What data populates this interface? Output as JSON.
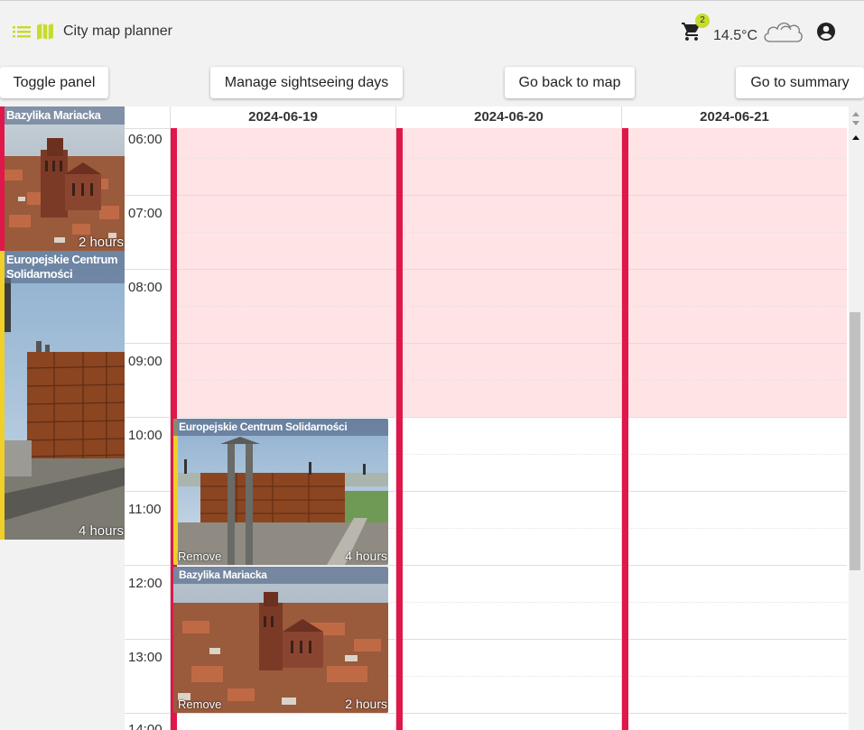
{
  "app": {
    "title": "City map planner",
    "icons": [
      "list-icon",
      "map-icon"
    ]
  },
  "header": {
    "cart_count": "2",
    "temperature": "14.5°C",
    "weather_icon": "cloud-icon",
    "account_icon": "account-circle-icon"
  },
  "toolbar": {
    "toggle_panel": "Toggle panel",
    "manage_days": "Manage sightseeing days",
    "back_to_map": "Go back to map",
    "summary": "Go to summary"
  },
  "panel": {
    "items": [
      {
        "title": "Bazylika Mariacka",
        "duration": "2 hours",
        "color": "#e0174a"
      },
      {
        "title": "Europejskie Centrum Solidarności",
        "duration": "4 hours",
        "color": "#f0d028"
      }
    ]
  },
  "calendar": {
    "days": [
      "2024-06-19",
      "2024-06-20",
      "2024-06-21"
    ],
    "times": [
      "06:00",
      "07:00",
      "08:00",
      "09:00",
      "10:00",
      "11:00",
      "12:00",
      "13:00",
      "14:00"
    ],
    "unavailable": {
      "from": "06:00",
      "to": "10:00",
      "color": "#ffe3e5"
    },
    "day_bar_color": "#e0174a",
    "events": [
      {
        "day": "2024-06-19",
        "start": "10:00",
        "end": "12:00",
        "title": "Europejskie Centrum Solidarności",
        "remove": "Remove",
        "duration": "4 hours",
        "color": "#f0d028"
      },
      {
        "day": "2024-06-19",
        "start": "12:00",
        "end": "14:00",
        "title": "Bazylika Mariacka",
        "remove": "Remove",
        "duration": "2 hours",
        "color": "#e0174a"
      }
    ]
  },
  "colors": {
    "accent": "#c7dc2a",
    "event_red": "#e0174a",
    "event_yellow": "#f0d028"
  }
}
